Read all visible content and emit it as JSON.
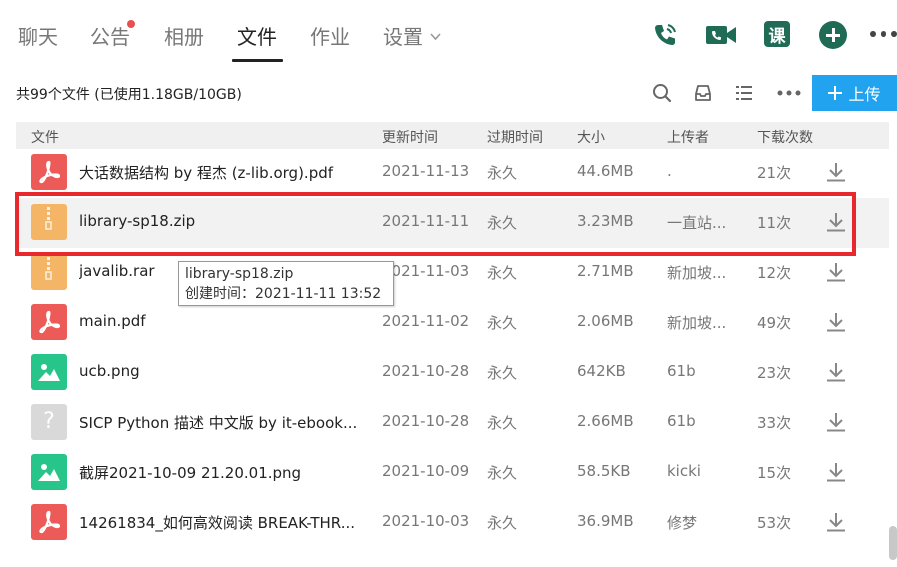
{
  "tabs": [
    {
      "label": "聊天"
    },
    {
      "label": "公告"
    },
    {
      "label": "相册"
    },
    {
      "label": "文件"
    },
    {
      "label": "作业"
    },
    {
      "label": "设置"
    }
  ],
  "top_actions": {
    "course_label": "课"
  },
  "summary": "共99个文件 (已使用1.18GB/10GB)",
  "upload_label": "上传",
  "columns": [
    "文件",
    "更新时间",
    "过期时间",
    "大小",
    "上传者",
    "下载次数"
  ],
  "files": [
    {
      "name": "大话数据结构 by 程杰 (z-lib.org).pdf",
      "date": "2021-11-13",
      "expiry": "永久",
      "size": "44.6MB",
      "uploader": ".",
      "downloads": "21次",
      "type": "pdf"
    },
    {
      "name": "library-sp18.zip",
      "date": "2021-11-11",
      "expiry": "永久",
      "size": "3.23MB",
      "uploader": "一直站...",
      "downloads": "11次",
      "type": "zip"
    },
    {
      "name": "javalib.rar",
      "date": "2021-11-03",
      "expiry": "永久",
      "size": "2.71MB",
      "uploader": "新加坡...",
      "downloads": "12次",
      "type": "zip"
    },
    {
      "name": "main.pdf",
      "date": "2021-11-02",
      "expiry": "永久",
      "size": "2.06MB",
      "uploader": "新加坡...",
      "downloads": "49次",
      "type": "pdf"
    },
    {
      "name": "ucb.png",
      "date": "2021-10-28",
      "expiry": "永久",
      "size": "642KB",
      "uploader": "61b",
      "downloads": "23次",
      "type": "img"
    },
    {
      "name": "SICP Python 描述 中文版 by it-ebook...",
      "date": "2021-10-28",
      "expiry": "永久",
      "size": "2.66MB",
      "uploader": "61b",
      "downloads": "33次",
      "type": "unk"
    },
    {
      "name": "截屏2021-10-09 21.20.01.png",
      "date": "2021-10-09",
      "expiry": "永久",
      "size": "58.5KB",
      "uploader": "kicki",
      "downloads": "15次",
      "type": "img"
    },
    {
      "name": "14261834_如何高效阅读 BREAK-THR...",
      "date": "2021-10-03",
      "expiry": "永久",
      "size": "36.9MB",
      "uploader": "修梦",
      "downloads": "53次",
      "type": "pdf"
    }
  ],
  "tooltip": {
    "line1": "library-sp18.zip",
    "line2": "创建时间：2021-11-11 13:52"
  },
  "colors": {
    "accent": "#22a3f0",
    "highlight": "#e8282c",
    "brand_green": "#1f6b55",
    "pdf": "#ec5b57",
    "zip": "#f4b566",
    "img": "#27c58a"
  }
}
